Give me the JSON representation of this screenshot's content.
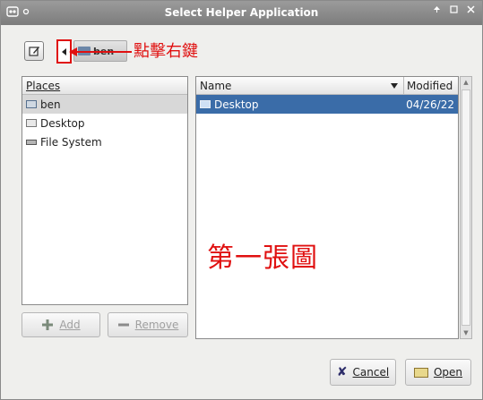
{
  "window": {
    "title": "Select Helper Application",
    "titlebar_right_icons": [
      "pin-icon",
      "maximize-icon",
      "close-icon"
    ]
  },
  "toolbar": {
    "path_segment": "ben"
  },
  "annotations": {
    "right_click_note": "點擊右鍵",
    "figure_caption": "第一張圖"
  },
  "places": {
    "header": "Places",
    "items": [
      {
        "label": "ben",
        "icon": "home-folder-icon",
        "selected": true
      },
      {
        "label": "Desktop",
        "icon": "desktop-folder-icon",
        "selected": false
      },
      {
        "label": "File System",
        "icon": "drive-icon",
        "selected": false
      }
    ],
    "add_label": "Add",
    "remove_label": "Remove"
  },
  "files": {
    "columns": {
      "name": "Name",
      "modified": "Modified"
    },
    "rows": [
      {
        "name": "Desktop",
        "modified": "04/26/22",
        "selected": true
      }
    ]
  },
  "actions": {
    "cancel_label": "Cancel",
    "open_label": "Open"
  },
  "colors": {
    "selection": "#3a6ca8",
    "annotation": "#e01010"
  }
}
